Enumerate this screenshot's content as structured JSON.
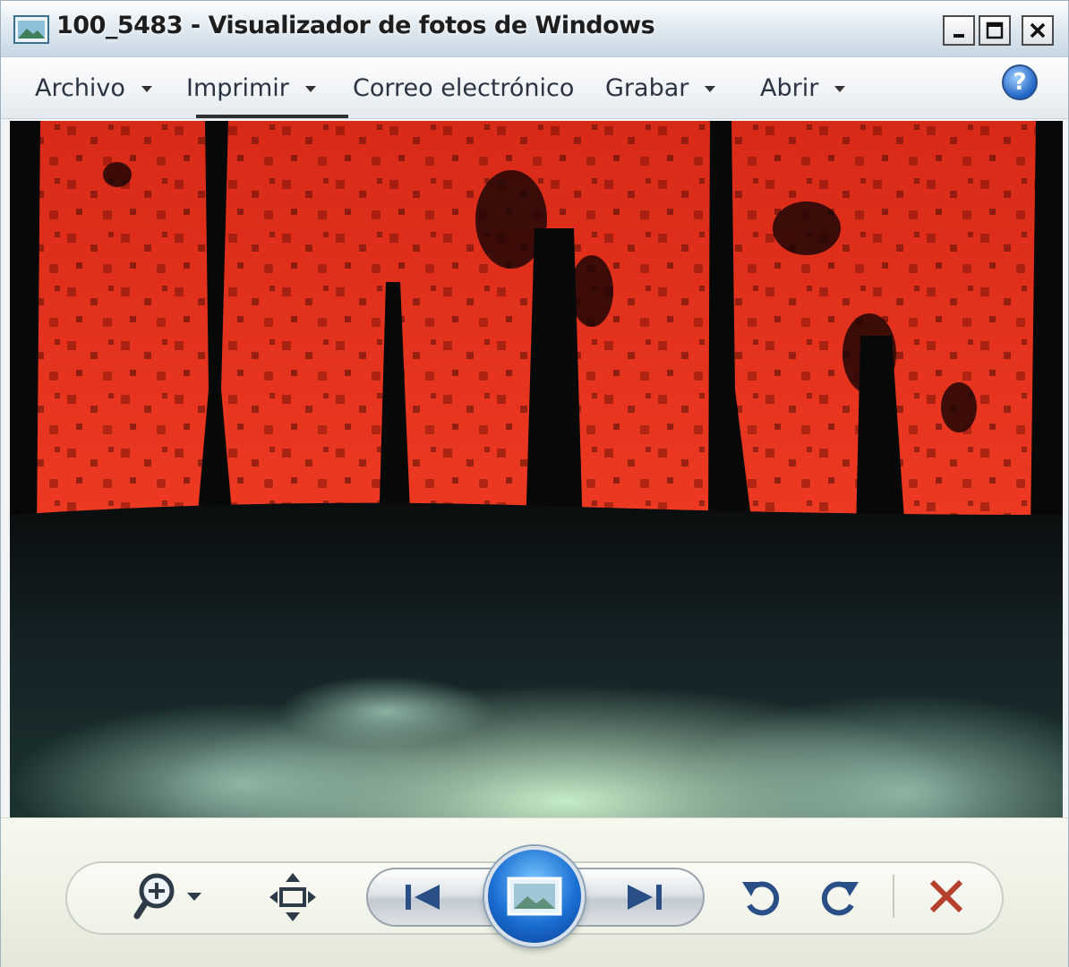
{
  "window": {
    "title": "100_5483 - Visualizador de fotos de Windows",
    "controls": {
      "minimize_icon": "minimize-icon",
      "maximize_icon": "maximize-icon",
      "close_icon": "close-icon"
    }
  },
  "menu": {
    "items": [
      {
        "label": "Archivo",
        "has_dropdown": true
      },
      {
        "label": "Imprimir",
        "has_dropdown": true
      },
      {
        "label": "Correo electrónico",
        "has_dropdown": false
      },
      {
        "label": "Grabar",
        "has_dropdown": true
      },
      {
        "label": "Abrir",
        "has_dropdown": true
      }
    ],
    "help_label": "?"
  },
  "controls": {
    "zoom_icon": "zoom-icon",
    "fit_icon": "actual-size-icon",
    "prev_icon": "previous-icon",
    "slideshow_icon": "slideshow-icon",
    "next_icon": "next-icon",
    "rotate_ccw_icon": "rotate-counterclockwise-icon",
    "rotate_cw_icon": "rotate-clockwise-icon",
    "delete_icon": "delete-icon"
  },
  "colors": {
    "photo_sky": "#e0301c",
    "photo_trees": "#0a0d0c",
    "photo_fog": "#c8eec8",
    "accent_blue": "#1b6fd3",
    "delete_red": "#b5402e"
  }
}
